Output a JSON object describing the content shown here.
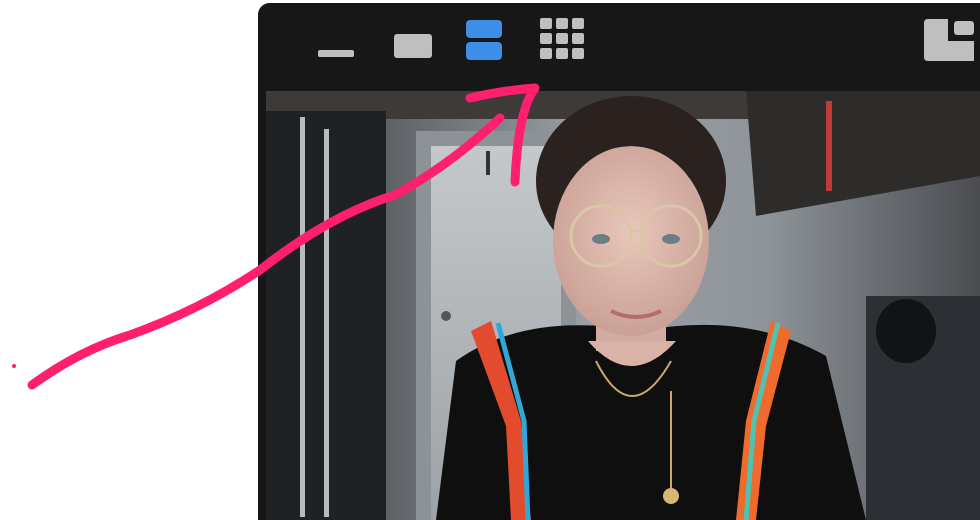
{
  "toolbar": {
    "buttons": [
      {
        "name": "minimized-view-button",
        "icon": "minimize-icon",
        "active": false
      },
      {
        "name": "single-speaker-view-button",
        "icon": "single-view-icon",
        "active": false
      },
      {
        "name": "side-by-side-view-button",
        "icon": "stacked-view-icon",
        "active": true
      },
      {
        "name": "gallery-view-button",
        "icon": "grid-view-icon",
        "active": false
      },
      {
        "name": "pip-view-button",
        "icon": "picture-in-picture-icon",
        "active": false
      }
    ]
  },
  "colors": {
    "toolbar_bg": "#171717",
    "icon_inactive": "#bfbfbf",
    "icon_active": "#3d8ee6",
    "annotation": "#ff1f6e"
  },
  "annotation": {
    "type": "hand-drawn-arrow",
    "points_to": "gallery-view-button"
  }
}
